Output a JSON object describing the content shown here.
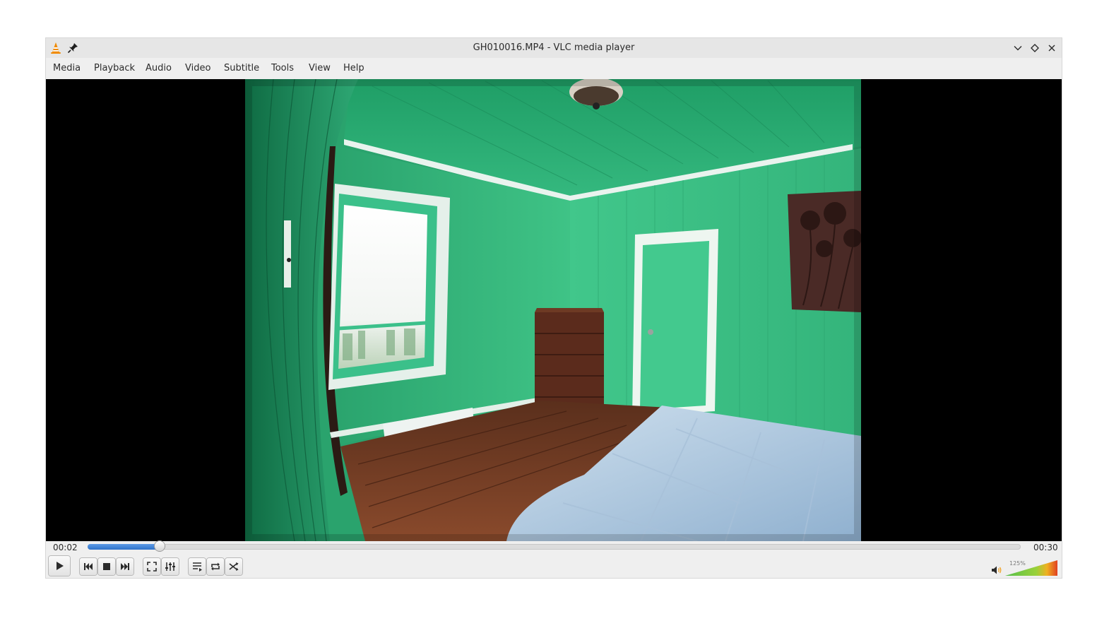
{
  "window": {
    "title": "GH010016.MP4 - VLC media player"
  },
  "menu": [
    "Media",
    "Playback",
    "Audio",
    "Video",
    "Subtitle",
    "Tools",
    "View",
    "Help"
  ],
  "playback": {
    "elapsed": "00:02",
    "duration": "00:30",
    "progress_fraction": 0.077
  },
  "volume": {
    "label": "125%",
    "level_fraction": 1.0
  },
  "icons": {
    "app": "vlc-cone-icon",
    "pin": "pin-icon",
    "minimize": "chevron-down-icon",
    "maximize": "diamond-icon",
    "close": "close-icon",
    "play": "play-icon",
    "previous": "skip-previous-icon",
    "stop": "stop-icon",
    "next": "skip-next-icon",
    "fullscreen": "fullscreen-icon",
    "extended": "equalizer-icon",
    "playlist": "playlist-icon",
    "loop": "loop-icon",
    "shuffle": "shuffle-icon",
    "volume": "speaker-icon"
  },
  "colors": {
    "accent": "#2f72c9",
    "video_bg": "#000000",
    "wall": "#2fb37a"
  }
}
